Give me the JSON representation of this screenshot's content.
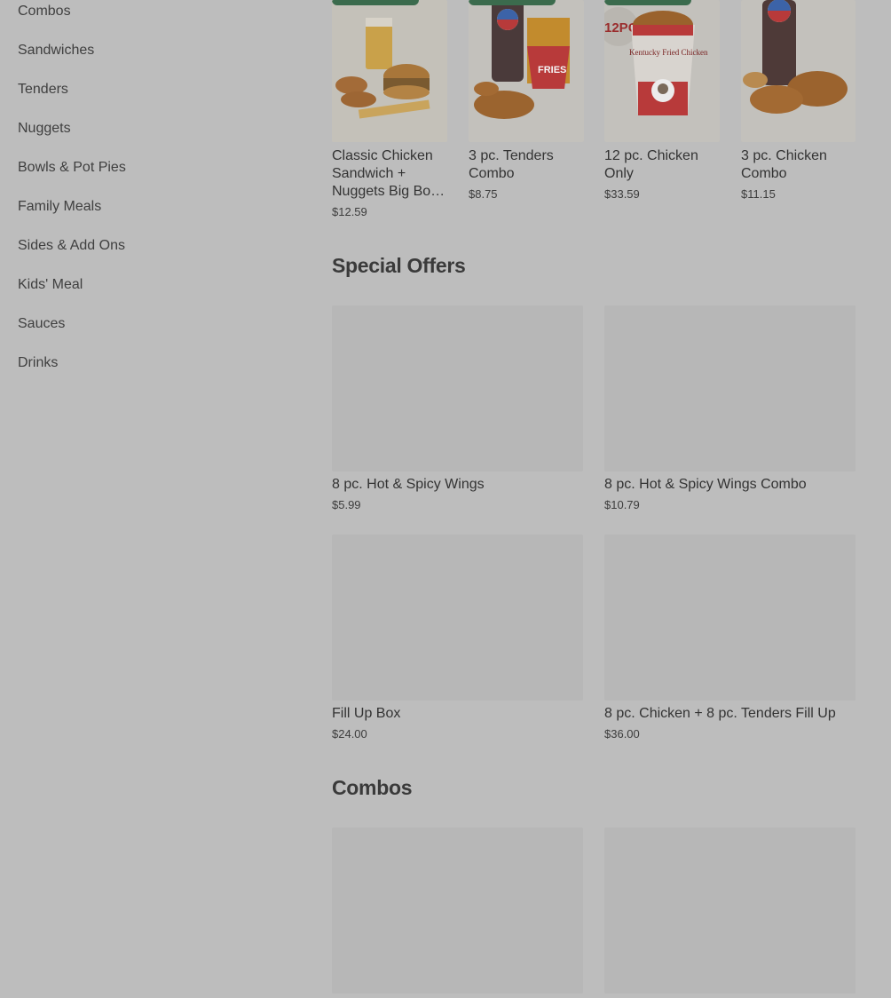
{
  "sidebar": {
    "items": [
      {
        "label": "Combos"
      },
      {
        "label": "Sandwiches"
      },
      {
        "label": "Tenders"
      },
      {
        "label": "Nuggets"
      },
      {
        "label": "Bowls & Pot Pies"
      },
      {
        "label": "Family Meals"
      },
      {
        "label": "Sides & Add Ons"
      },
      {
        "label": "Kids' Meal"
      },
      {
        "label": "Sauces"
      },
      {
        "label": "Drinks"
      }
    ]
  },
  "featured": {
    "items": [
      {
        "name": "Classic Chicken Sandwich + Nuggets Big Bo…",
        "price": "$12.59",
        "image_icon": "sandwich-meal-icon"
      },
      {
        "name": "3 pc. Tenders Combo",
        "price": "$8.75",
        "image_icon": "tenders-combo-icon"
      },
      {
        "name": "12 pc. Chicken Only",
        "price": "$33.59",
        "image_icon": "chicken-bucket-icon"
      },
      {
        "name": "3 pc. Chicken Combo",
        "price": "$11.15",
        "image_icon": "chicken-combo-icon"
      }
    ],
    "bucket_badge": "12PC",
    "bucket_text": "Kentucky Fried Chicken",
    "fries_text": "FRIES"
  },
  "special_offers": {
    "title": "Special Offers",
    "items": [
      {
        "name": "8 pc. Hot & Spicy Wings",
        "price": "$5.99"
      },
      {
        "name": "8 pc. Hot & Spicy Wings Combo",
        "price": "$10.79"
      },
      {
        "name": "Fill Up Box",
        "price": "$24.00"
      },
      {
        "name": "8 pc. Chicken + 8 pc. Tenders Fill Up",
        "price": "$36.00"
      }
    ]
  },
  "combos": {
    "title": "Combos"
  },
  "colors": {
    "overlay_bg": "#bdbdbd",
    "badge_green": "#3b6b4d"
  }
}
